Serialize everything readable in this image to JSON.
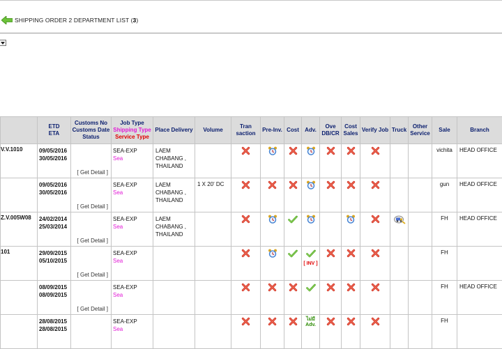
{
  "header": {
    "title": "SHIPPING ORDER 2 DEPARTMENT LIST (",
    "count": "3",
    "close": ")"
  },
  "columns": {
    "etd": "ETD",
    "eta": "ETA",
    "customs_1": "Customs No",
    "customs_2": "Customs Date",
    "customs_3": "Status",
    "job_1": "Job Type",
    "job_2": "Shipping Type",
    "job_3": "Service Type",
    "place": "Place Delivery",
    "volume": "Volume",
    "tran_1": "Tran",
    "tran_2": "saction",
    "preinv": "Pre-Inv.",
    "cost": "Cost",
    "adv": "Adv.",
    "ove_1": "Ove",
    "ove_2": "DB/CR",
    "cs_1": "Cost",
    "cs_2": "Sales",
    "verify": "Verify Job",
    "truck": "Truck",
    "other_1": "Other",
    "other_2": "Service",
    "sale": "Sale",
    "branch": "Branch"
  },
  "detail_label": "[ Get Detail ]",
  "inv_label": "[ INV ]",
  "adv_text_1": "ไม่มี",
  "adv_text_2": "Adv.",
  "rows": [
    {
      "code": "V.V.1010",
      "etd": "09/05/2016",
      "eta": "30/05/2016",
      "job": "SEA-EXP",
      "service": "Sea",
      "place_1": "LAEM",
      "place_2": "CHABANG ,",
      "place_3": "THAILAND",
      "volume": "",
      "sale": "vichita",
      "branch": "HEAD OFFICE"
    },
    {
      "code": "",
      "etd": "09/05/2016",
      "eta": "30/05/2016",
      "job": "SEA-EXP",
      "service": "Sea",
      "place_1": "LAEM",
      "place_2": "CHABANG ,",
      "place_3": "THAILAND",
      "volume": "1 X 20' DC",
      "sale": "gun",
      "branch": "HEAD OFFICE"
    },
    {
      "code": "Z.V.005W08",
      "etd": "24/02/2014",
      "eta": "25/03/2014",
      "job": "SEA-EXP",
      "service": "Sea",
      "place_1": "LAEM",
      "place_2": "CHABANG ,",
      "place_3": "THAILAND",
      "volume": "",
      "sale": "FH",
      "branch": "HEAD OFFICE"
    },
    {
      "code": "101",
      "etd": "29/09/2015",
      "eta": "05/10/2015",
      "job": "SEA-EXP",
      "service": "Sea",
      "place_1": "",
      "place_2": "",
      "place_3": "",
      "volume": "",
      "sale": "FH",
      "branch": ""
    },
    {
      "code": "",
      "etd": "08/09/2015",
      "eta": "08/09/2015",
      "job": "SEA-EXP",
      "service": "Sea",
      "place_1": "",
      "place_2": "",
      "place_3": "",
      "volume": "",
      "sale": "FH",
      "branch": "HEAD OFFICE"
    },
    {
      "code": "",
      "etd": "28/08/2015",
      "eta": "28/08/2015",
      "job": "SEA-EXP",
      "service": "Sea",
      "place_1": "",
      "place_2": "",
      "place_3": "",
      "volume": "",
      "sale": "FH",
      "branch": ""
    }
  ]
}
